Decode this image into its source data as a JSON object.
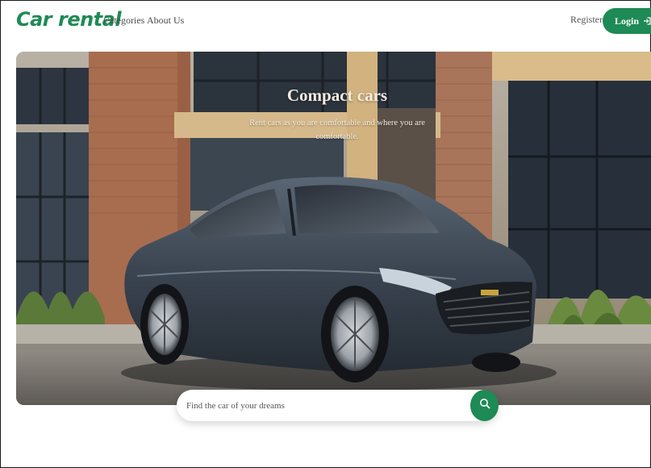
{
  "nav": {
    "brand": "Car rental",
    "links": [
      {
        "label": "Categories"
      },
      {
        "label": "About Us"
      }
    ],
    "register_label": "Register",
    "login_label": "Login"
  },
  "hero": {
    "title": "Compact cars",
    "subtitle": "Rent cars as you are comfortable and where you are comfortable."
  },
  "search": {
    "placeholder": "Find the car of your dreams"
  },
  "colors": {
    "accent": "#1e8a55",
    "brand": "#1e8a55"
  },
  "icons": {
    "login": "login-arrow-icon",
    "search": "search-icon"
  }
}
